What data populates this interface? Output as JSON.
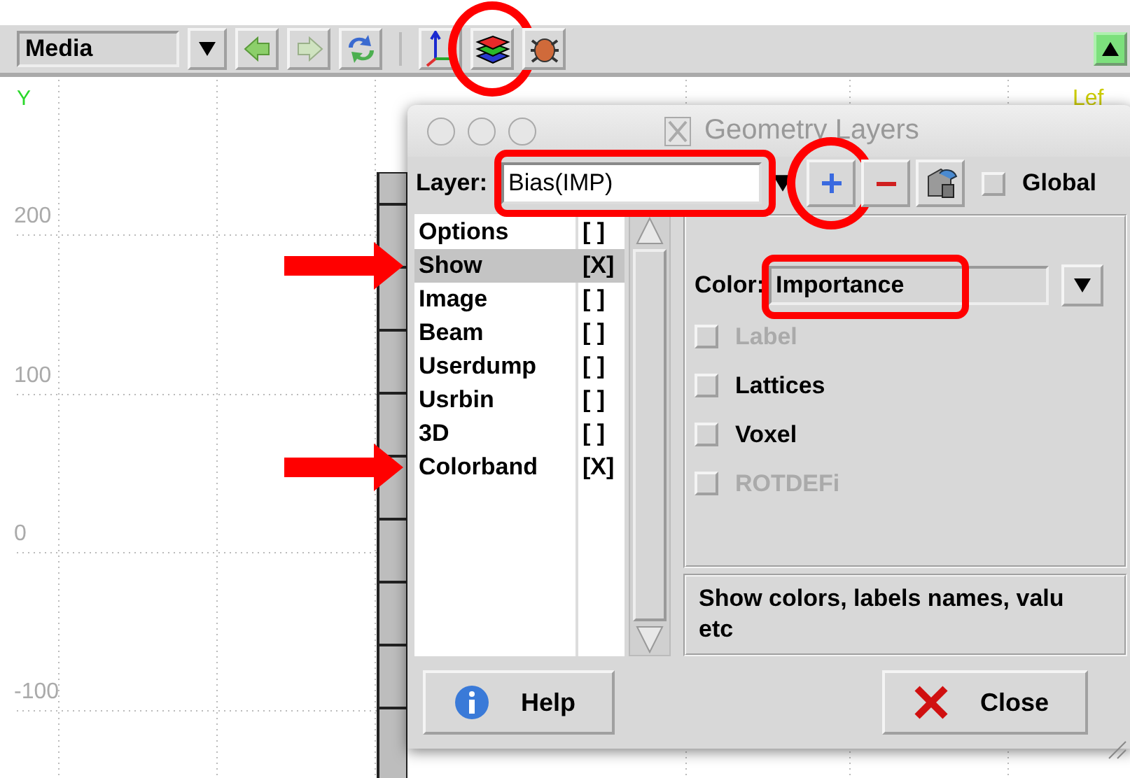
{
  "toolbar": {
    "material": "Media",
    "buttons": [
      {
        "kind": "back",
        "highlighted": false
      },
      {
        "kind": "forward",
        "highlighted": false
      },
      {
        "kind": "refresh",
        "highlighted": false
      },
      {
        "kind": "axes",
        "highlighted": false
      },
      {
        "kind": "layers",
        "highlighted": true
      },
      {
        "kind": "bug",
        "highlighted": false
      }
    ]
  },
  "plot": {
    "axis_label": "Y",
    "y_ticks": [
      "200",
      "100",
      "0",
      "-100"
    ],
    "corner_label": "Lef"
  },
  "dialog": {
    "title": "Geometry Layers",
    "layer": {
      "label": "Layer:",
      "value": "Bias(IMP)",
      "highlighted": true
    },
    "tools": [
      {
        "kind": "add",
        "highlighted": true
      },
      {
        "kind": "remove",
        "highlighted": false
      },
      {
        "kind": "edit",
        "highlighted": false
      }
    ],
    "global": {
      "label": "Global",
      "checked": false
    },
    "layers": [
      {
        "name": "Options",
        "flag": "[ ]",
        "selected": false,
        "marked": false
      },
      {
        "name": "Show",
        "flag": "[X]",
        "selected": true,
        "marked": true
      },
      {
        "name": "Image",
        "flag": "[ ]",
        "selected": false,
        "marked": false
      },
      {
        "name": "Beam",
        "flag": "[ ]",
        "selected": false,
        "marked": false
      },
      {
        "name": "Userdump",
        "flag": "[ ]",
        "selected": false,
        "marked": false
      },
      {
        "name": "Usrbin",
        "flag": "[ ]",
        "selected": false,
        "marked": false
      },
      {
        "name": "3D",
        "flag": "[ ]",
        "selected": false,
        "marked": false
      },
      {
        "name": "Colorband",
        "flag": "[X]",
        "selected": false,
        "marked": true
      }
    ],
    "color": {
      "label": "Color:",
      "value": "Importance",
      "highlighted": true
    },
    "options": [
      {
        "label": "Label",
        "checked": false,
        "disabled": true
      },
      {
        "label": "Lattices",
        "checked": false,
        "disabled": false
      },
      {
        "label": "Voxel",
        "checked": false,
        "disabled": false
      },
      {
        "label": "ROTDEFi",
        "checked": false,
        "disabled": true
      }
    ],
    "info_lines": [
      "Show colors, labels names, valu",
      "etc"
    ],
    "buttons": [
      {
        "kind": "help",
        "label": "Help"
      },
      {
        "kind": "close",
        "label": "Close"
      }
    ]
  }
}
